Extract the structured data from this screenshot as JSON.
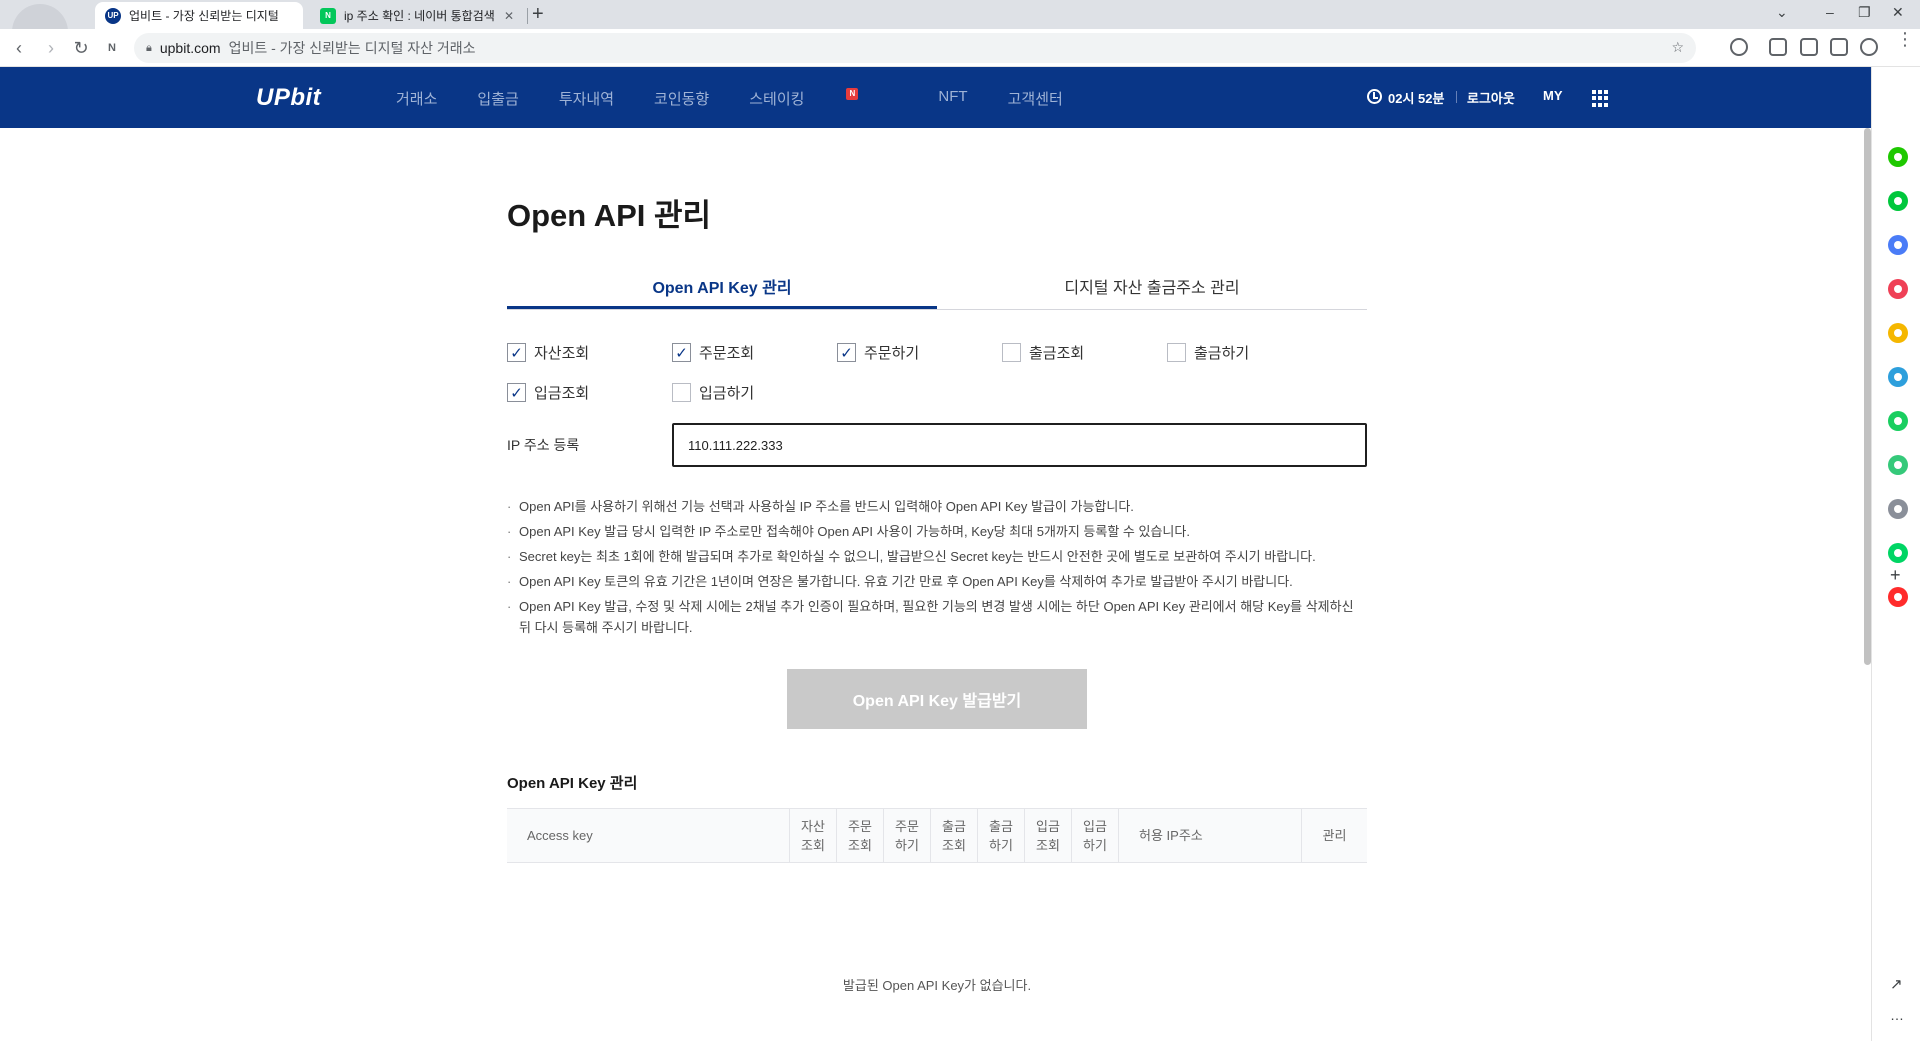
{
  "browser": {
    "tabs": [
      {
        "title": "업비트 - 가장 신뢰받는 디지털",
        "favicon_color": "#093687",
        "favicon_text": "UP",
        "active": true
      },
      {
        "title": "ip 주소 확인 : 네이버 통합검색",
        "favicon_color": "#03c75a",
        "favicon_text": "N",
        "active": false
      }
    ],
    "new_tab": "+",
    "address": {
      "host": "upbit.com",
      "page_title": "업비트 - 가장 신뢰받는 디지털 자산 거래소"
    }
  },
  "header": {
    "logo": "UPbit",
    "nav": [
      "거래소",
      "입출금",
      "투자내역",
      "코인동향",
      "스테이킹",
      "NFT",
      "고객센터"
    ],
    "staking_badge": "N",
    "time": "02시 52분",
    "logout": "로그아웃",
    "my": "MY"
  },
  "page": {
    "title": "Open API 관리",
    "tabs": [
      "Open API Key 관리",
      "디지털 자산 출금주소 관리"
    ],
    "permissions": [
      {
        "label": "자산조회",
        "checked": true
      },
      {
        "label": "주문조회",
        "checked": true
      },
      {
        "label": "주문하기",
        "checked": true
      },
      {
        "label": "출금조회",
        "checked": false
      },
      {
        "label": "출금하기",
        "checked": false
      },
      {
        "label": "입금조회",
        "checked": true
      },
      {
        "label": "입금하기",
        "checked": false
      }
    ],
    "ip_label": "IP 주소 등록",
    "ip_value": "110.111.222.333",
    "notes": [
      "Open API를 사용하기 위해선 기능 선택과 사용하실 IP 주소를 반드시 입력해야 Open API Key 발급이 가능합니다.",
      "Open API Key 발급 당시 입력한 IP 주소로만 접속해야 Open API 사용이 가능하며, Key당 최대 5개까지 등록할 수 있습니다.",
      "Secret key는 최초 1회에 한해 발급되며 추가로 확인하실 수 없으니, 발급받으신 Secret key는 반드시 안전한 곳에 별도로 보관하여 주시기 바랍니다.",
      "Open API Key 토큰의 유효 기간은 1년이며 연장은 불가합니다. 유효 기간 만료 후 Open API Key를 삭제하여 추가로 발급받아 주시기 바랍니다.",
      "Open API Key 발급, 수정 및 삭제 시에는 2채널 추가 인증이 필요하며, 필요한 기능의 변경 발생 시에는 하단 Open API Key 관리에서 해당 Key를 삭제하신 뒤 다시 등록해 주시기 바랍니다."
    ],
    "issue_button": "Open API Key 발급받기",
    "key_section_title": "Open API Key 관리",
    "table_headers": [
      "Access key",
      "자산조회",
      "주문조회",
      "주문하기",
      "출금조회",
      "출금하기",
      "입금조회",
      "입금하기",
      "허용 IP주소",
      "관리"
    ],
    "empty_message": "발급된 Open API Key가 없습니다."
  },
  "sidebar_icons": [
    {
      "name": "sidebar-green-circle-icon",
      "color": "#1ec800"
    },
    {
      "name": "sidebar-chat-icon",
      "color": "#00c73c"
    },
    {
      "name": "sidebar-calendar-icon",
      "color": "#4a7cf7"
    },
    {
      "name": "sidebar-pocket-icon",
      "color": "#ef4056"
    },
    {
      "name": "sidebar-star-icon",
      "color": "#f5b700"
    },
    {
      "name": "sidebar-edge-icon",
      "color": "#2d9fdc"
    },
    {
      "name": "sidebar-green-square-icon",
      "color": "#19ce60"
    },
    {
      "name": "sidebar-play-icon",
      "color": "#35c97a"
    },
    {
      "name": "sidebar-character-icon",
      "color": "#8a8f99"
    },
    {
      "name": "sidebar-webtoon-icon",
      "color": "#00d564"
    },
    {
      "name": "sidebar-now-icon",
      "color": "#ff2b2b"
    }
  ],
  "colors": {
    "brand": "#093687",
    "disabled_button": "#c9c9c9"
  }
}
